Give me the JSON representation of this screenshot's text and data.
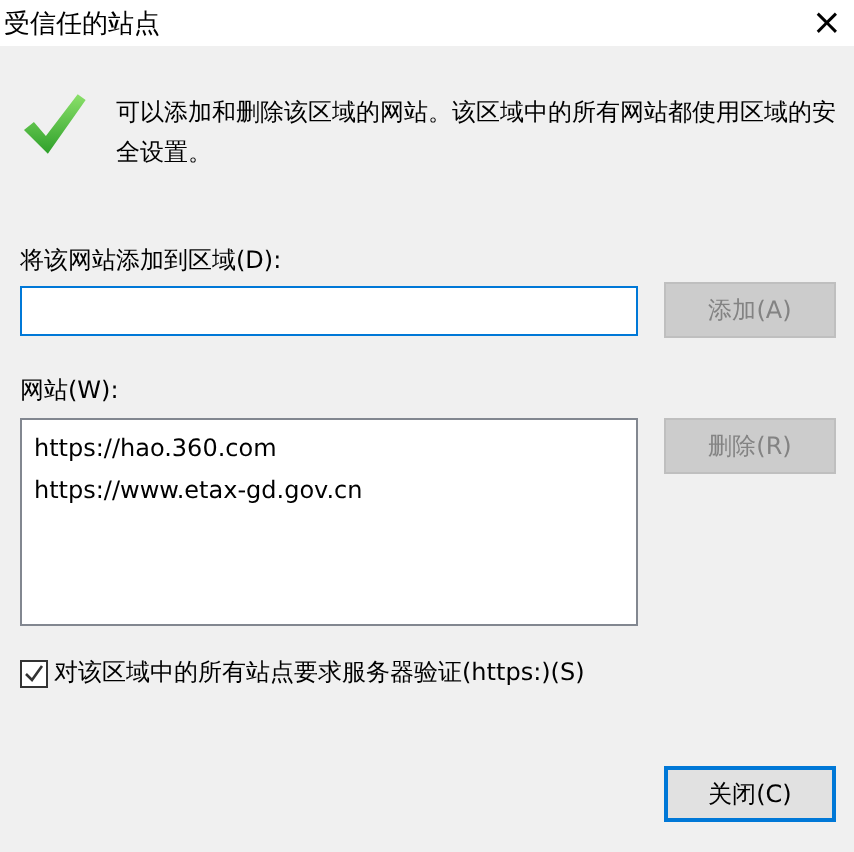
{
  "window": {
    "title": "受信任的站点",
    "close": "×"
  },
  "description": "可以添加和删除该区域的网站。该区域中的所有网站都使用区域的安全设置。",
  "add_field": {
    "label": "将该网站添加到区域(D):",
    "focused": true
  },
  "add_button": {
    "label": "添加(A)",
    "disabled": true
  },
  "websites": {
    "label": "网站(W):",
    "items": [
      {
        "text": "https://hao.360.com",
        "selected": false
      },
      {
        "text": "https://www.etax-gd.gov.cn",
        "selected": false
      }
    ]
  },
  "remove_button": {
    "label": "删除(R)",
    "disabled": true
  },
  "require_https": {
    "label": "对该区域中的所有站点要求服务器验证(https:)(S)",
    "checked": true
  },
  "close_button": {
    "label": "关闭(C)",
    "default": true
  }
}
